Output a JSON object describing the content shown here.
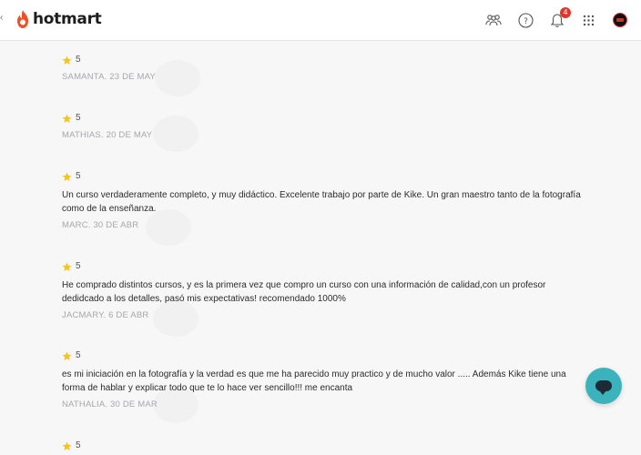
{
  "header": {
    "brand_name": "hotmart",
    "brand_color": "#f04e23",
    "icons": {
      "community": "community-icon",
      "help": "help-icon",
      "notifications": "bell-icon",
      "apps": "apps-grid-icon",
      "avatar": "avatar"
    },
    "notification_count": "4",
    "help_glyph": "?"
  },
  "reviews": [
    {
      "rating": "5",
      "comment": "",
      "meta": "SAMANTA. 23 DE MAY"
    },
    {
      "rating": "5",
      "comment": "",
      "meta": "MATHIAS. 20 DE MAY"
    },
    {
      "rating": "5",
      "comment": "Un curso verdaderamente completo, y muy didáctico. Excelente trabajo por parte de Kike. Un gran maestro tanto de la fotografía como de la enseñanza.",
      "meta": "MARC. 30 DE ABR"
    },
    {
      "rating": "5",
      "comment": "He comprado distintos cursos, y es la primera vez que compro un curso con una información de calidad,con un profesor dedidcado a los detalles, pasó mis expectativas! recomendado 1000%",
      "meta": "JACMARY. 6 DE ABR"
    },
    {
      "rating": "5",
      "comment": "es mi iniciación en la fotografía y la verdad es que me ha parecido muy practico y de mucho valor ..... Además Kike tiene una forma de hablar y explicar todo que te lo hace ver sencillo!!! me encanta",
      "meta": "NATHALIA. 30 DE MAR"
    },
    {
      "rating": "5",
      "comment": "",
      "meta": ""
    }
  ],
  "colors": {
    "star": "#f5c518",
    "chat_button": "#3bb3bd",
    "badge": "#e0372d"
  },
  "chat_button": {
    "icon": "chat-icon"
  }
}
